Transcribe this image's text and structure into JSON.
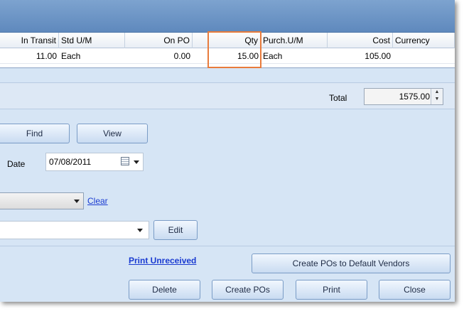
{
  "grid": {
    "columns": [
      "In Transit",
      "Std U/M",
      "On PO",
      "Qty",
      "Purch.U/M",
      "Cost",
      "Currency"
    ],
    "row": [
      "11.00",
      "Each",
      "0.00",
      "15.00",
      "Each",
      "105.00",
      ""
    ]
  },
  "total": {
    "label": "Total",
    "value": "1575.00"
  },
  "buttons": {
    "find": "Find",
    "view": "View",
    "edit": "Edit",
    "create_default": "Create POs to Default Vendors",
    "delete": "Delete",
    "create_pos": "Create POs",
    "print": "Print",
    "close": "Close"
  },
  "date": {
    "label": "Date",
    "value": "07/08/2011"
  },
  "clear_link": "Clear",
  "print_unreceived": "Print Unreceived",
  "icons": {
    "calendar": "calendar-icon",
    "spin": "spin-updown-icon",
    "dropdown": "chevron-down-icon"
  },
  "colors": {
    "highlight": "#e87b3c",
    "link": "#1a3bd1",
    "panel": "#d6e5f5",
    "button_border": "#7a9cc6"
  }
}
